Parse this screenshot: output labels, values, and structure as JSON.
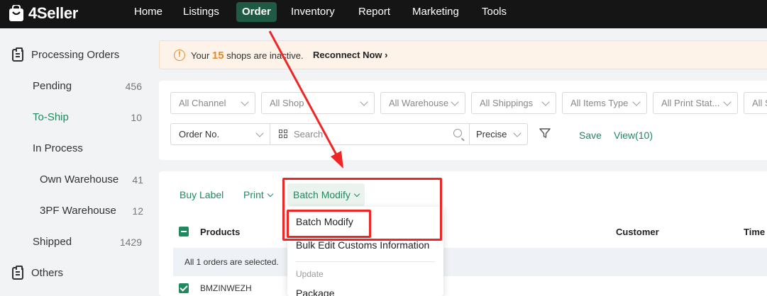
{
  "app": {
    "name": "4Seller"
  },
  "nav": {
    "items": [
      {
        "label": "Home",
        "active": false
      },
      {
        "label": "Listings",
        "active": false
      },
      {
        "label": "Order",
        "active": true
      },
      {
        "label": "Inventory",
        "active": false
      },
      {
        "label": "Report",
        "active": false
      },
      {
        "label": "Marketing",
        "active": false
      },
      {
        "label": "Tools",
        "active": false
      }
    ]
  },
  "sidebar": {
    "section1": "Processing Orders",
    "items": [
      {
        "label": "Pending",
        "count": "456"
      },
      {
        "label": "To-Ship",
        "count": "10",
        "active": true
      },
      {
        "label": "In Process",
        "count": ""
      },
      {
        "label": "Own Warehouse",
        "count": "41"
      },
      {
        "label": "3PF Warehouse",
        "count": "12"
      },
      {
        "label": "Shipped",
        "count": "1429"
      }
    ],
    "section2": "Others"
  },
  "alert": {
    "prefix": "Your",
    "count": "15",
    "suffix": "shops are inactive.",
    "link": "Reconnect Now"
  },
  "filters": {
    "selects": [
      "All Channel",
      "All Shop",
      "All Warehouse",
      "All Shippings",
      "All Items Type",
      "All Print Stat...",
      "All S"
    ],
    "search_field": "Order No.",
    "search_placeholder": "Search",
    "match_mode": "Precise",
    "save_label": "Save",
    "view_label": "View(10)"
  },
  "toolbar": {
    "buy_label": "Buy Label",
    "print_label": "Print",
    "batch_label": "Batch Modify"
  },
  "table": {
    "columns": [
      "Products",
      "Customer",
      "Time"
    ],
    "selection_info": "All 1 orders are selected.",
    "rows": [
      {
        "order": "BMZINWEZH"
      }
    ]
  },
  "dropdown": {
    "items": [
      "Batch Modify",
      "Bulk Edit Customs Information"
    ],
    "group_label": "Update",
    "group_items": [
      "Package"
    ]
  },
  "colors": {
    "accent": "#1f8a5e",
    "nav_bg": "#151515",
    "warning": "#e8892b",
    "annotation": "#ef2626"
  }
}
